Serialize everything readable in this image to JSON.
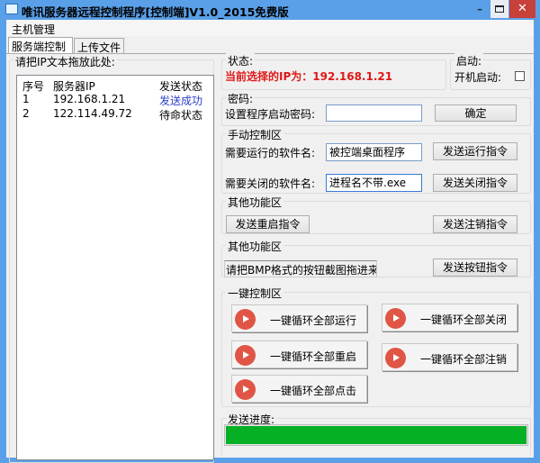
{
  "window": {
    "title": "唯讯服务器远程控制程序[控制端]V1.0_2015免费版",
    "minimize": "–",
    "close": "✕"
  },
  "menu": {
    "item": "主机管理"
  },
  "tabs": [
    {
      "label": "服务端控制"
    },
    {
      "label": "上传文件"
    }
  ],
  "left": {
    "group_label": "请把IP文本拖放此处:",
    "columns": [
      "序号",
      "服务器IP",
      "发送状态"
    ],
    "rows": [
      {
        "no": "1",
        "ip": "192.168.1.21",
        "status": "发送成功",
        "status_color": "#2a3fc8"
      },
      {
        "no": "2",
        "ip": "122.114.49.72",
        "status": "待命状态",
        "status_color": "#000000"
      }
    ]
  },
  "status": {
    "label": "状态:",
    "text": "当前选择的IP为：192.168.1.21",
    "color": "#e01818"
  },
  "startup": {
    "label": "启动:",
    "checkbox_label": "开机启动:",
    "checked": false
  },
  "password": {
    "label": "密码:",
    "field_label": "设置程序启动密码:",
    "value": "",
    "confirm": "确定"
  },
  "manual": {
    "label": "手动控制区",
    "run_label": "需要运行的软件名:",
    "run_value": "被控端桌面程序",
    "run_button": "发送运行指令",
    "close_label": "需要关闭的软件名:",
    "close_value": "进程名不带.exe",
    "close_button": "发送关闭指令"
  },
  "other1": {
    "label": "其他功能区",
    "restart": "发送重启指令",
    "logout": "发送注销指令"
  },
  "other2": {
    "label": "其他功能区",
    "hint": "请把BMP格式的按钮截图拖进来",
    "button": "发送按钮指令"
  },
  "onekey": {
    "label": "一键控制区",
    "buttons": [
      "一键循环全部运行",
      "一键循环全部关闭",
      "一键循环全部重启",
      "一键循环全部注销",
      "一键循环全部点击"
    ]
  },
  "progress": {
    "label": "发送进度:",
    "value_percent": 100
  }
}
